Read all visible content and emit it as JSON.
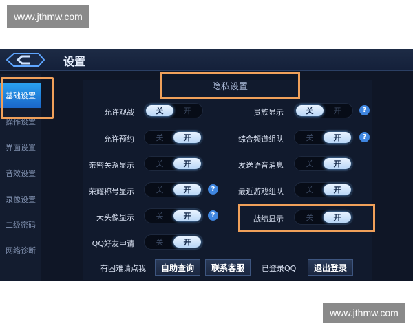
{
  "watermarks": {
    "top": "www.jthmw.com",
    "bottom": "www.jthmw.com"
  },
  "header": {
    "title": "设置"
  },
  "sidebar": {
    "items": [
      {
        "label": "基础设置",
        "active": true
      },
      {
        "label": "操作设置"
      },
      {
        "label": "界面设置"
      },
      {
        "label": "音效设置"
      },
      {
        "label": "录像设置"
      },
      {
        "label": "二级密码"
      },
      {
        "label": "网络诊断"
      }
    ]
  },
  "privacy": {
    "section_title": "隐私设置",
    "toggle_off": "关",
    "toggle_on": "开",
    "left": [
      {
        "label": "允许观战",
        "value": "关"
      },
      {
        "label": "允许预约",
        "value": "开"
      },
      {
        "label": "亲密关系显示",
        "value": "开"
      },
      {
        "label": "荣耀称号显示",
        "value": "开",
        "help": "?"
      },
      {
        "label": "大头像显示",
        "value": "开",
        "help": "?"
      },
      {
        "label": "QQ好友申请",
        "value": "开"
      }
    ],
    "right": [
      {
        "label": "贵族显示",
        "value": "关",
        "help": "?"
      },
      {
        "label": "综合频道组队",
        "value": "开",
        "help": "?"
      },
      {
        "label": "发送语音消息",
        "value": "开"
      },
      {
        "label": "最近游戏组队",
        "value": "开"
      },
      {
        "label": "战绩显示",
        "value": "开"
      }
    ]
  },
  "footer": {
    "help_text": "有困难请点我",
    "self_service": "自助查询",
    "contact": "联系客服",
    "logged_in": "已登录QQ",
    "logout": "退出登录"
  },
  "colors": {
    "accent": "#2aa0f0",
    "highlight": "#f0a05a",
    "background": "#0f1626"
  }
}
